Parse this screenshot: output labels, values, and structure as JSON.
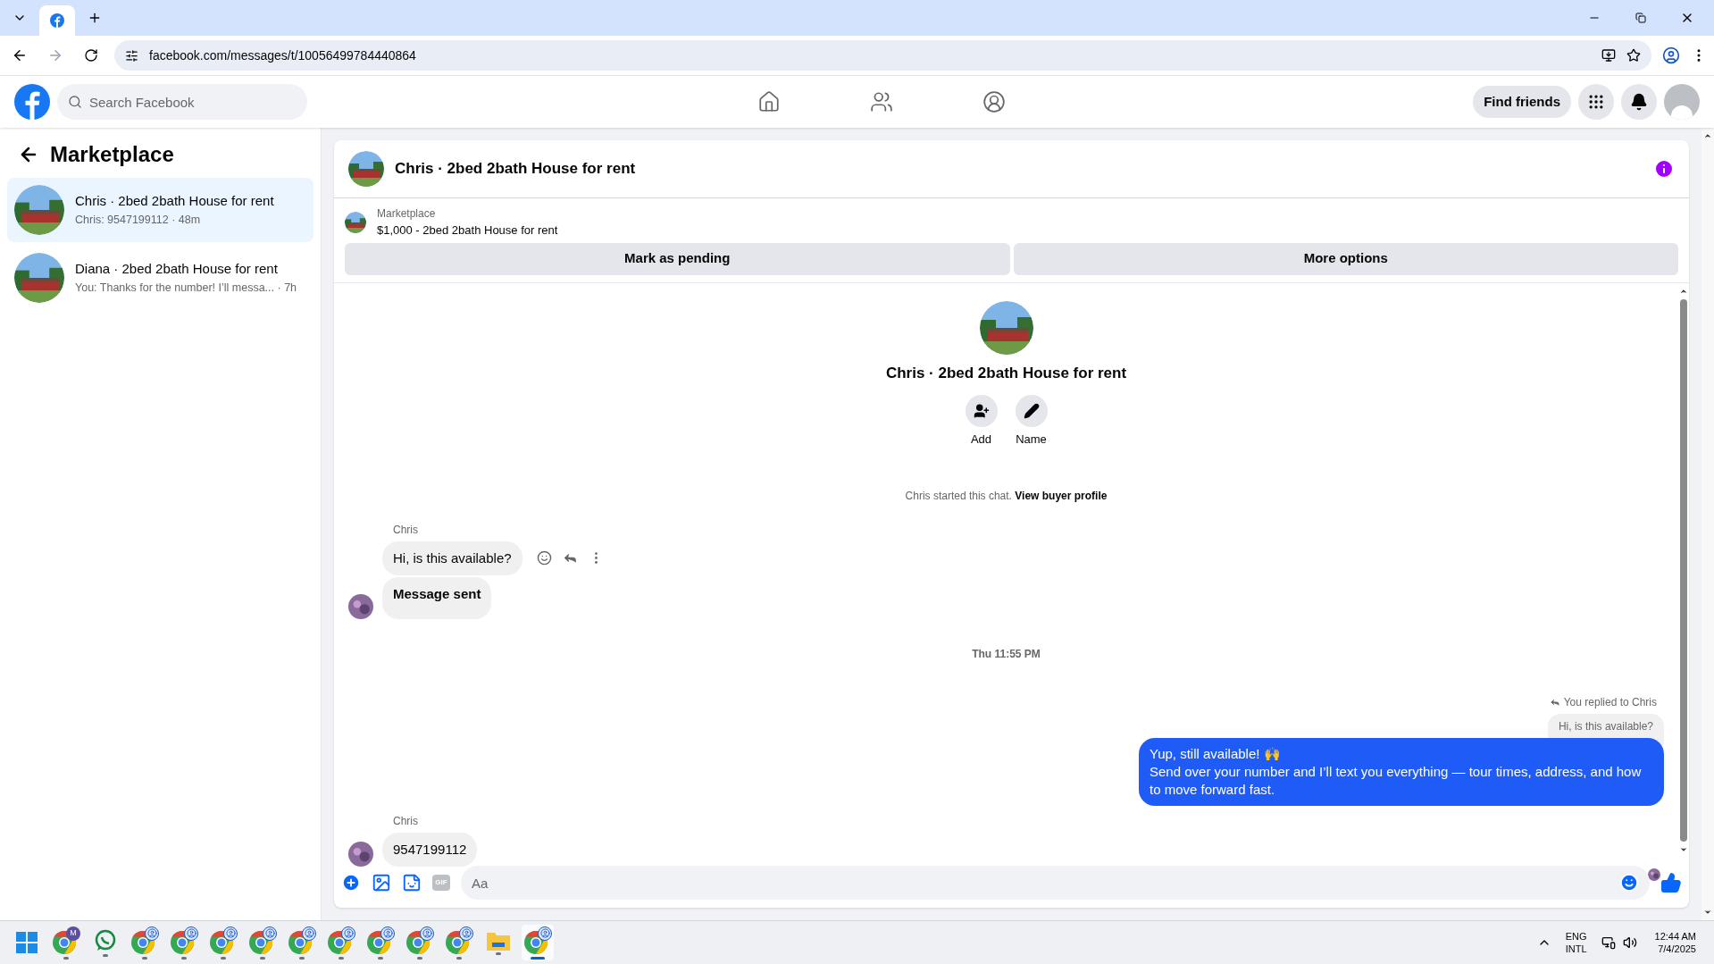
{
  "browser": {
    "url": "facebook.com/messages/t/10056499784440864"
  },
  "header": {
    "search_placeholder": "Search Facebook",
    "find_friends": "Find friends"
  },
  "sidebar": {
    "title": "Marketplace",
    "conversations": [
      {
        "name": "Chris · 2bed 2bath House for rent",
        "preview": "Chris: 9547199112 · 48m",
        "selected": true
      },
      {
        "name": "Diana · 2bed 2bath House for rent",
        "preview": "You: Thanks for the number! I’ll messa... · 7h",
        "selected": false
      }
    ]
  },
  "chat": {
    "title": "Chris · 2bed 2bath House for rent",
    "listing": {
      "label": "Marketplace",
      "text": "$1,000 - 2bed 2bath House for rent"
    },
    "actions": [
      "Mark as pending",
      "More options"
    ],
    "intro": {
      "title": "Chris · 2bed 2bath House for rent",
      "actions": [
        {
          "kind": "add",
          "label": "Add"
        },
        {
          "kind": "name",
          "label": "Name"
        }
      ]
    },
    "started_note": {
      "text": "Chris started this chat.",
      "link": "View buyer profile"
    },
    "messages": [
      {
        "kind": "incoming",
        "sender": "Chris",
        "bubbles": [
          {
            "text": "Hi, is this available?",
            "bold": false,
            "hovered": true
          },
          {
            "text": "Message sent",
            "bold": true,
            "hovered": false
          }
        ]
      },
      {
        "kind": "timestamp",
        "text": "Thu 11:55 PM"
      },
      {
        "kind": "outgoing",
        "reply_note": "You replied to Chris",
        "quoted": "Hi, is this available?",
        "lines": [
          "Yup, still available! 🙌",
          "Send over your number and I’ll text you everything — tour times, address, and how to move forward fast."
        ]
      },
      {
        "kind": "incoming",
        "sender": "Chris",
        "bubbles": [
          {
            "text": "9547199112",
            "bold": false,
            "hovered": false
          }
        ]
      }
    ],
    "composer_placeholder": "Aa",
    "gif_label": "GIF"
  },
  "taskbar": {
    "apps": [
      {
        "kind": "windows",
        "selected": false
      },
      {
        "kind": "chrome",
        "badge": "M",
        "selected": false
      },
      {
        "kind": "whatsapp",
        "selected": false
      },
      {
        "kind": "chrome-profile",
        "selected": false
      },
      {
        "kind": "chrome-profile",
        "selected": false
      },
      {
        "kind": "chrome-profile",
        "selected": false
      },
      {
        "kind": "chrome-profile",
        "selected": false
      },
      {
        "kind": "chrome-profile",
        "selected": false
      },
      {
        "kind": "chrome-profile",
        "selected": false
      },
      {
        "kind": "chrome-profile",
        "selected": false
      },
      {
        "kind": "chrome-profile",
        "selected": false
      },
      {
        "kind": "chrome-profile",
        "selected": false
      },
      {
        "kind": "files",
        "selected": false
      },
      {
        "kind": "chrome-profile",
        "selected": true
      }
    ],
    "lang": [
      "ENG",
      "INTL"
    ],
    "time": "12:44 AM",
    "date": "7/4/2025"
  }
}
